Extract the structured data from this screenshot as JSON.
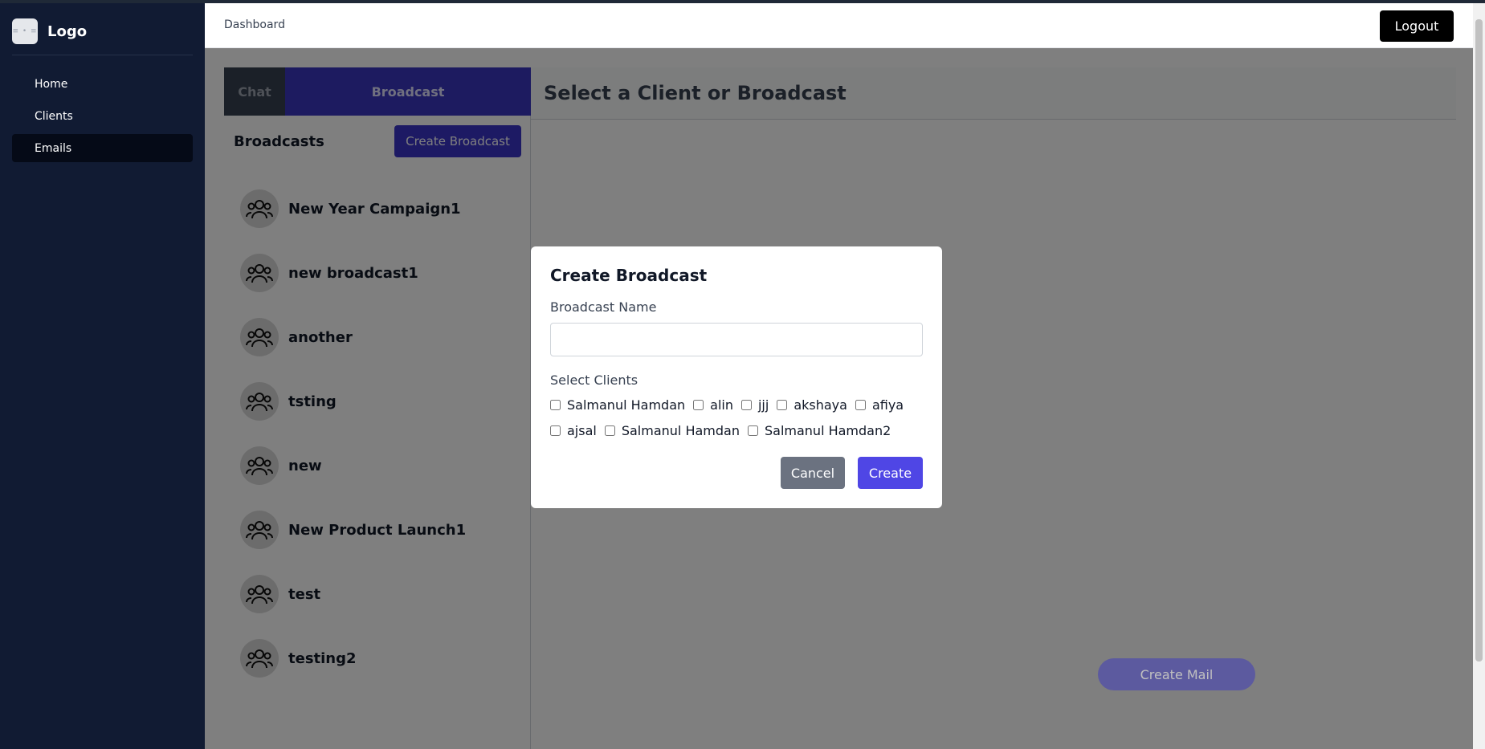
{
  "brand": {
    "name": "Logo",
    "icon_text": "≡ • ≡"
  },
  "nav": {
    "items": [
      {
        "label": "Home"
      },
      {
        "label": "Clients"
      },
      {
        "label": "Emails"
      }
    ],
    "active": "Emails"
  },
  "header": {
    "title": "Dashboard",
    "logout_label": "Logout"
  },
  "tabs": {
    "chat": "Chat",
    "broadcast": "Broadcast",
    "active": "Broadcast"
  },
  "broadcasts": {
    "title": "Broadcasts",
    "create_label": "Create Broadcast",
    "items": [
      {
        "name": "New Year Campaign1"
      },
      {
        "name": "new broadcast1"
      },
      {
        "name": "another"
      },
      {
        "name": "tsting"
      },
      {
        "name": "new"
      },
      {
        "name": "New Product Launch1"
      },
      {
        "name": "test"
      },
      {
        "name": "testing2"
      }
    ]
  },
  "right_panel": {
    "title": "Select a Client or Broadcast"
  },
  "create_mail_label": "Create Mail",
  "modal": {
    "title": "Create Broadcast",
    "name_label": "Broadcast Name",
    "name_value": "",
    "clients_label": "Select Clients",
    "clients": [
      {
        "name": "Salmanul Hamdan",
        "checked": false
      },
      {
        "name": "alin",
        "checked": false
      },
      {
        "name": "jjj",
        "checked": false
      },
      {
        "name": "akshaya",
        "checked": false
      },
      {
        "name": "afiya",
        "checked": false
      },
      {
        "name": "ajsal",
        "checked": false
      },
      {
        "name": "Salmanul Hamdan",
        "checked": false
      },
      {
        "name": "Salmanul Hamdan2",
        "checked": false
      }
    ],
    "cancel_label": "Cancel",
    "create_label": "Create"
  },
  "colors": {
    "sidebar_bg": "#111b33",
    "accent": "#3a36c0",
    "create_button": "#4f46e5",
    "cancel_button": "#6b7280"
  }
}
